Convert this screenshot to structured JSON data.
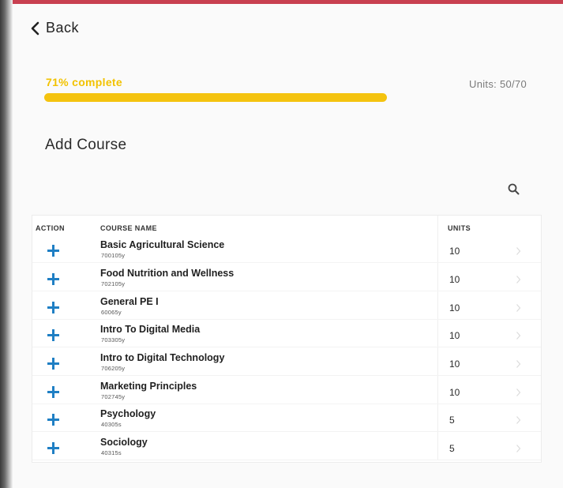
{
  "nav": {
    "back_label": "Back"
  },
  "progress": {
    "label": "71% complete",
    "percent": 71,
    "units_summary": "Units: 50/70"
  },
  "section": {
    "title": "Add Course"
  },
  "table": {
    "headers": {
      "action": "ACTION",
      "course_name": "COURSE NAME",
      "units": "UNITS"
    },
    "rows": [
      {
        "name": "Basic Agricultural Science",
        "code": "700105y",
        "units": "10"
      },
      {
        "name": "Food Nutrition and Wellness",
        "code": "702105y",
        "units": "10"
      },
      {
        "name": "General PE I",
        "code": "60065y",
        "units": "10"
      },
      {
        "name": "Intro To Digital Media",
        "code": "703305y",
        "units": "10"
      },
      {
        "name": "Intro to Digital Technology",
        "code": "706205y",
        "units": "10"
      },
      {
        "name": "Marketing Principles",
        "code": "702745y",
        "units": "10"
      },
      {
        "name": "Psychology",
        "code": "40305s",
        "units": "5"
      },
      {
        "name": "Sociology",
        "code": "40315s",
        "units": "5"
      }
    ]
  },
  "icons": {
    "back": "chevron-left-icon",
    "search": "search-icon",
    "add": "plus-icon",
    "row_open": "chevron-right-icon"
  },
  "colors": {
    "progress_fill": "#f4c30f",
    "progress_text": "#f2c200",
    "add_icon": "#1f7fc4",
    "top_accent": "#c84050"
  }
}
